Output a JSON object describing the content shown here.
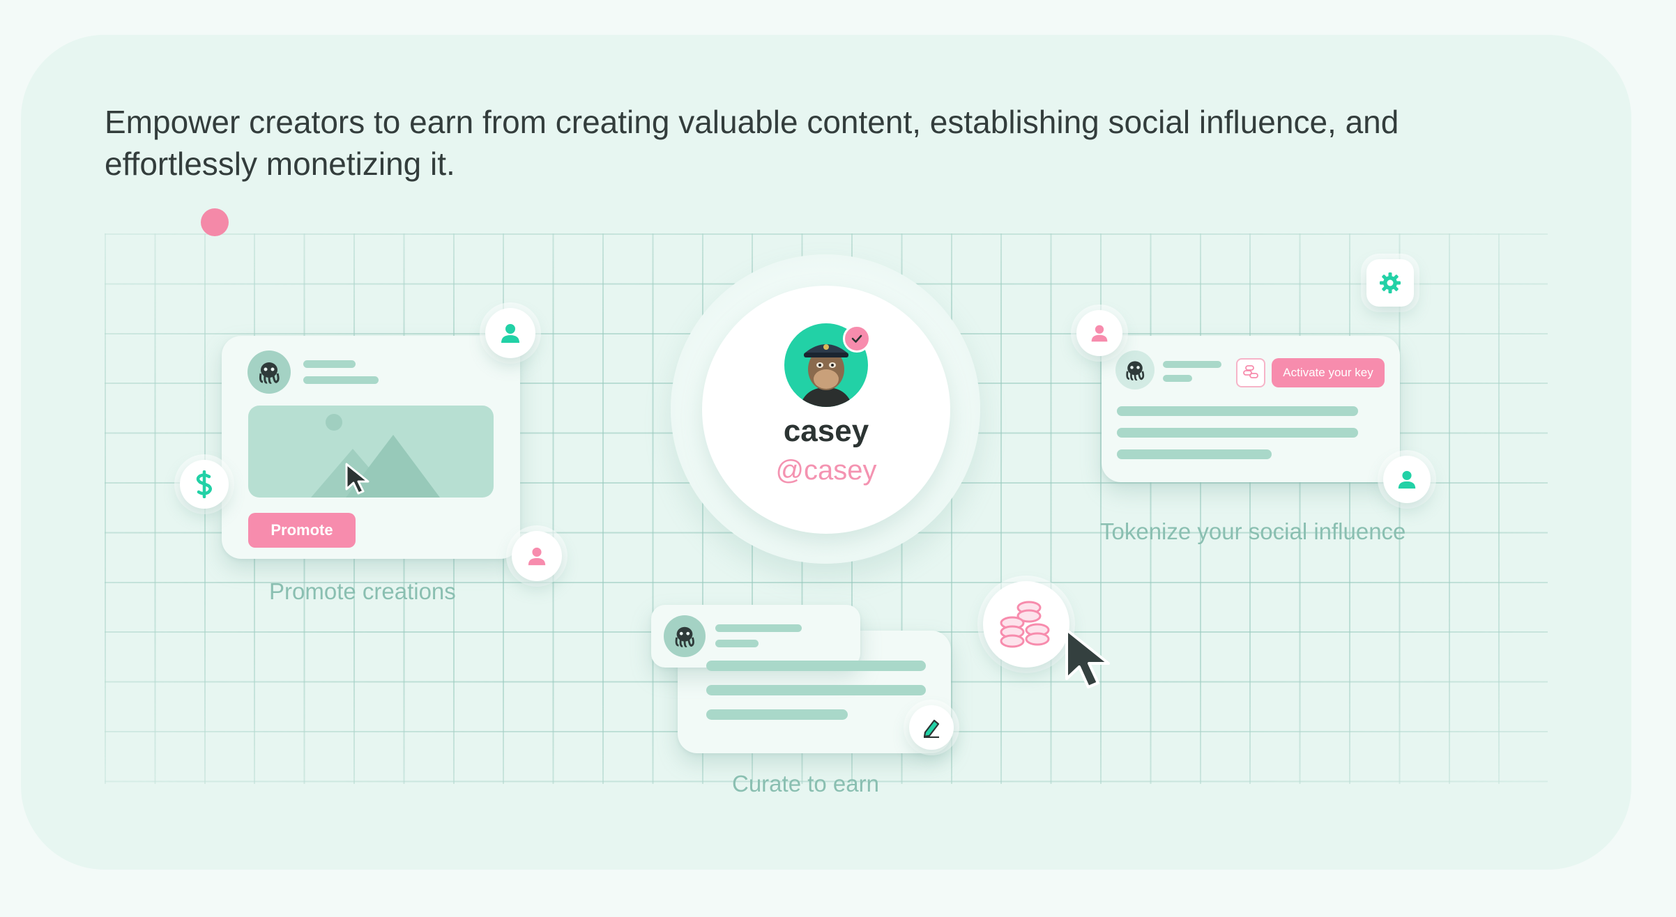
{
  "headline": "Empower creators to earn from creating valuable content, establishing social influence, and effortlessly monetizing it.",
  "profile": {
    "name": "casey",
    "handle": "@casey"
  },
  "promote_card": {
    "button_label": "Promote",
    "caption": "Promote creations"
  },
  "tokenize_card": {
    "button_label": "Activate your key",
    "caption": "Tokenize your social influence"
  },
  "curate_card": {
    "caption": "Curate to earn"
  },
  "colors": {
    "accent_pink": "#f78cad",
    "accent_green": "#22d1a6",
    "panel_bg": "#e7f6f1",
    "text_dark": "#333d3c"
  },
  "icons": [
    "user-icon",
    "dollar-icon",
    "cursor-icon",
    "gear-icon",
    "coins-icon",
    "pen-icon",
    "check-icon",
    "octopus-avatar-icon",
    "ape-avatar-icon"
  ]
}
